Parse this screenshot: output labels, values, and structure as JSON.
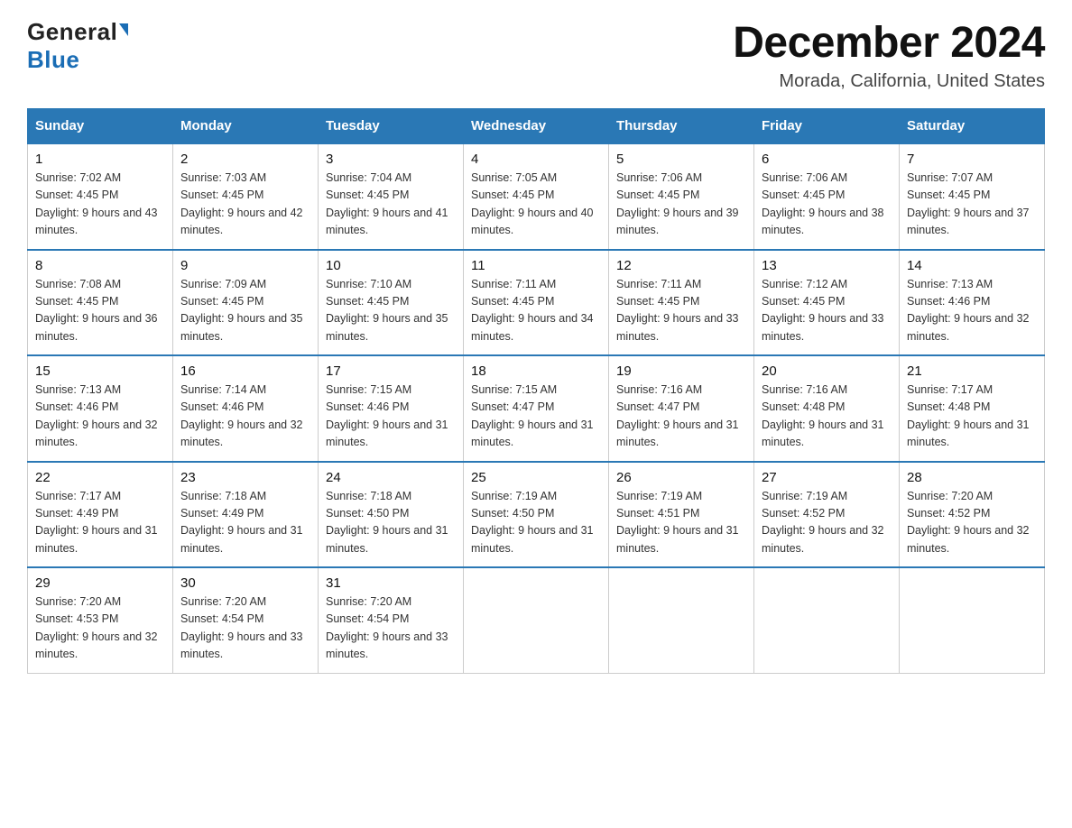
{
  "logo": {
    "general": "General",
    "blue": "Blue"
  },
  "title": "December 2024",
  "subtitle": "Morada, California, United States",
  "weekdays": [
    "Sunday",
    "Monday",
    "Tuesday",
    "Wednesday",
    "Thursday",
    "Friday",
    "Saturday"
  ],
  "weeks": [
    [
      {
        "day": "1",
        "sunrise": "7:02 AM",
        "sunset": "4:45 PM",
        "daylight": "9 hours and 43 minutes."
      },
      {
        "day": "2",
        "sunrise": "7:03 AM",
        "sunset": "4:45 PM",
        "daylight": "9 hours and 42 minutes."
      },
      {
        "day": "3",
        "sunrise": "7:04 AM",
        "sunset": "4:45 PM",
        "daylight": "9 hours and 41 minutes."
      },
      {
        "day": "4",
        "sunrise": "7:05 AM",
        "sunset": "4:45 PM",
        "daylight": "9 hours and 40 minutes."
      },
      {
        "day": "5",
        "sunrise": "7:06 AM",
        "sunset": "4:45 PM",
        "daylight": "9 hours and 39 minutes."
      },
      {
        "day": "6",
        "sunrise": "7:06 AM",
        "sunset": "4:45 PM",
        "daylight": "9 hours and 38 minutes."
      },
      {
        "day": "7",
        "sunrise": "7:07 AM",
        "sunset": "4:45 PM",
        "daylight": "9 hours and 37 minutes."
      }
    ],
    [
      {
        "day": "8",
        "sunrise": "7:08 AM",
        "sunset": "4:45 PM",
        "daylight": "9 hours and 36 minutes."
      },
      {
        "day": "9",
        "sunrise": "7:09 AM",
        "sunset": "4:45 PM",
        "daylight": "9 hours and 35 minutes."
      },
      {
        "day": "10",
        "sunrise": "7:10 AM",
        "sunset": "4:45 PM",
        "daylight": "9 hours and 35 minutes."
      },
      {
        "day": "11",
        "sunrise": "7:11 AM",
        "sunset": "4:45 PM",
        "daylight": "9 hours and 34 minutes."
      },
      {
        "day": "12",
        "sunrise": "7:11 AM",
        "sunset": "4:45 PM",
        "daylight": "9 hours and 33 minutes."
      },
      {
        "day": "13",
        "sunrise": "7:12 AM",
        "sunset": "4:45 PM",
        "daylight": "9 hours and 33 minutes."
      },
      {
        "day": "14",
        "sunrise": "7:13 AM",
        "sunset": "4:46 PM",
        "daylight": "9 hours and 32 minutes."
      }
    ],
    [
      {
        "day": "15",
        "sunrise": "7:13 AM",
        "sunset": "4:46 PM",
        "daylight": "9 hours and 32 minutes."
      },
      {
        "day": "16",
        "sunrise": "7:14 AM",
        "sunset": "4:46 PM",
        "daylight": "9 hours and 32 minutes."
      },
      {
        "day": "17",
        "sunrise": "7:15 AM",
        "sunset": "4:46 PM",
        "daylight": "9 hours and 31 minutes."
      },
      {
        "day": "18",
        "sunrise": "7:15 AM",
        "sunset": "4:47 PM",
        "daylight": "9 hours and 31 minutes."
      },
      {
        "day": "19",
        "sunrise": "7:16 AM",
        "sunset": "4:47 PM",
        "daylight": "9 hours and 31 minutes."
      },
      {
        "day": "20",
        "sunrise": "7:16 AM",
        "sunset": "4:48 PM",
        "daylight": "9 hours and 31 minutes."
      },
      {
        "day": "21",
        "sunrise": "7:17 AM",
        "sunset": "4:48 PM",
        "daylight": "9 hours and 31 minutes."
      }
    ],
    [
      {
        "day": "22",
        "sunrise": "7:17 AM",
        "sunset": "4:49 PM",
        "daylight": "9 hours and 31 minutes."
      },
      {
        "day": "23",
        "sunrise": "7:18 AM",
        "sunset": "4:49 PM",
        "daylight": "9 hours and 31 minutes."
      },
      {
        "day": "24",
        "sunrise": "7:18 AM",
        "sunset": "4:50 PM",
        "daylight": "9 hours and 31 minutes."
      },
      {
        "day": "25",
        "sunrise": "7:19 AM",
        "sunset": "4:50 PM",
        "daylight": "9 hours and 31 minutes."
      },
      {
        "day": "26",
        "sunrise": "7:19 AM",
        "sunset": "4:51 PM",
        "daylight": "9 hours and 31 minutes."
      },
      {
        "day": "27",
        "sunrise": "7:19 AM",
        "sunset": "4:52 PM",
        "daylight": "9 hours and 32 minutes."
      },
      {
        "day": "28",
        "sunrise": "7:20 AM",
        "sunset": "4:52 PM",
        "daylight": "9 hours and 32 minutes."
      }
    ],
    [
      {
        "day": "29",
        "sunrise": "7:20 AM",
        "sunset": "4:53 PM",
        "daylight": "9 hours and 32 minutes."
      },
      {
        "day": "30",
        "sunrise": "7:20 AM",
        "sunset": "4:54 PM",
        "daylight": "9 hours and 33 minutes."
      },
      {
        "day": "31",
        "sunrise": "7:20 AM",
        "sunset": "4:54 PM",
        "daylight": "9 hours and 33 minutes."
      },
      null,
      null,
      null,
      null
    ]
  ]
}
